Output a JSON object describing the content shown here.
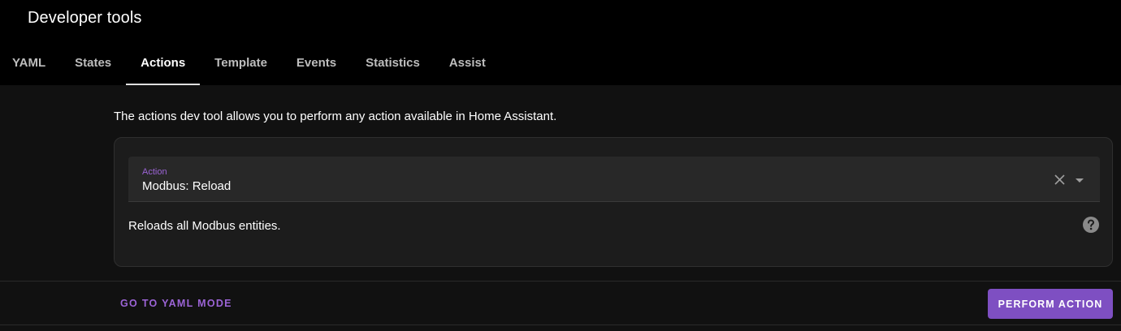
{
  "header": {
    "title": "Developer tools"
  },
  "tabs": [
    {
      "label": "YAML",
      "active": false
    },
    {
      "label": "States",
      "active": false
    },
    {
      "label": "Actions",
      "active": true
    },
    {
      "label": "Template",
      "active": false
    },
    {
      "label": "Events",
      "active": false
    },
    {
      "label": "Statistics",
      "active": false
    },
    {
      "label": "Assist",
      "active": false
    }
  ],
  "main": {
    "description": "The actions dev tool allows you to perform any action available in Home Assistant.",
    "action_field": {
      "label": "Action",
      "value": "Modbus: Reload",
      "clear_icon": "close-icon",
      "dropdown_icon": "caret-down-icon"
    },
    "action_description": "Reloads all Modbus entities.",
    "help_icon": "help-circle-icon"
  },
  "footer": {
    "yaml_mode_label": "GO TO YAML MODE",
    "perform_label": "PERFORM ACTION"
  },
  "colors": {
    "accent": "#7e4fc2",
    "accent_text": "#9c64d6",
    "header_bg": "#000000",
    "page_bg": "#111111",
    "card_bg": "#1c1c1c"
  }
}
